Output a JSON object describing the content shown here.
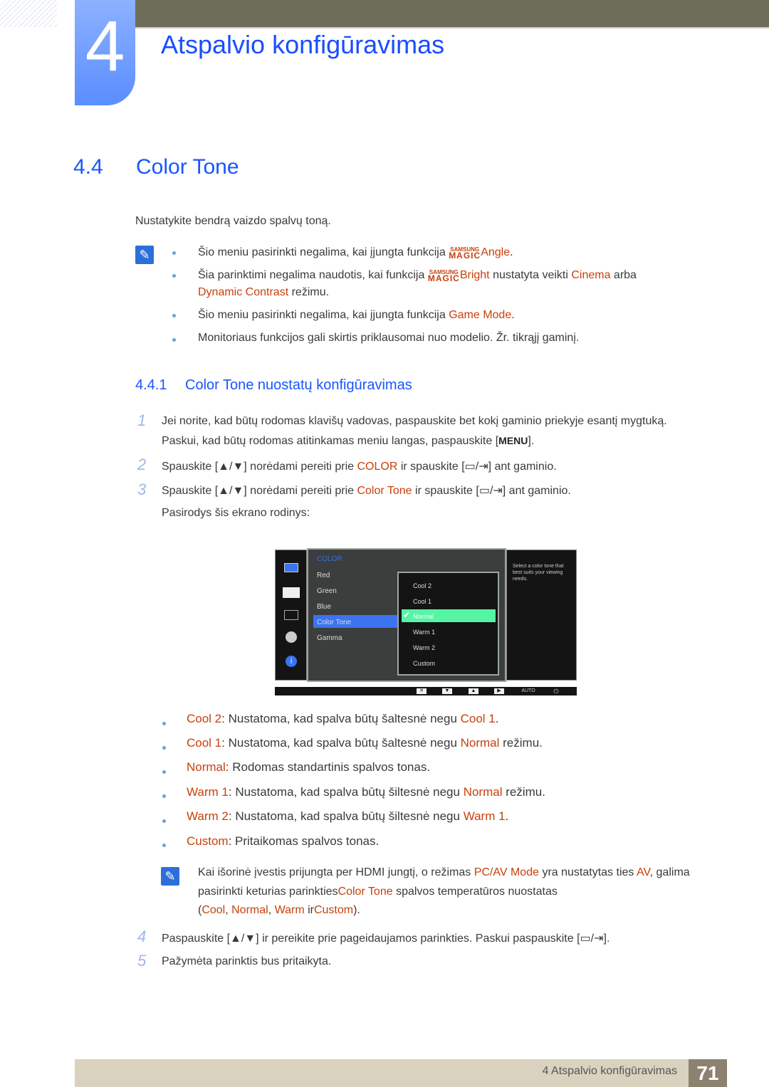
{
  "chapter": {
    "number": "4",
    "title": "Atspalvio konfigūravimas"
  },
  "section": {
    "number": "4.4",
    "title": "Color Tone"
  },
  "intro": "Nustatykite bendrą vaizdo spalvų toną.",
  "notes1": {
    "b1_pre": "Šio meniu pasirinkti negalima, kai įjungta funkcija ",
    "b1_hl": "Angle",
    "b1_post": ".",
    "b2_pre": "Šia parinktimi negalima naudotis, kai funkcija ",
    "b2_hl": "Bright",
    "b2_mid": " nustatyta veikti ",
    "b2_hl2": "Cinema",
    "b2_post": " arba",
    "b2_hl3": "Dynamic Contrast",
    "b2_post2": " režimu.",
    "b3_pre": "Šio meniu pasirinkti negalima, kai įjungta funkcija ",
    "b3_hl": "Game Mode",
    "b3_post": ".",
    "b4": "Monitoriaus funkcijos gali skirtis priklausomai nuo modelio. Žr. tikrąjį gaminį.",
    "magic_top": "SAMSUNG",
    "magic_bottom": "MAGIC"
  },
  "subsection": {
    "number": "4.4.1",
    "title": "Color Tone nuostatų konfigūravimas"
  },
  "steps": {
    "s1_num": "1",
    "s1_line1": "Jei norite, kad būtų rodomas klavišų vadovas, paspauskite bet kokį gaminio priekyje esantį mygtuką.",
    "s1_line2_pre": "Paskui, kad būtų rodomas atitinkamas meniu langas, paspauskite [",
    "s1_key": "MENU",
    "s1_line2_post": "].",
    "s2_num": "2",
    "s2_pre": "Spauskite [▲/▼] norėdami pereiti prie ",
    "s2_hl": "COLOR",
    "s2_post": " ir spauskite [▭/⇥] ant gaminio.",
    "s3_num": "3",
    "s3_pre": "Spauskite [▲/▼] norėdami pereiti prie ",
    "s3_hl": "Color Tone",
    "s3_post": " ir spauskite [▭/⇥] ant gaminio.",
    "s3_line2": "Pasirodys šis ekrano rodinys:",
    "s4_num": "4",
    "s4": "Paspauskite [▲/▼] ir pereikite prie pageidaujamos parinkties. Paskui paspauskite [▭/⇥].",
    "s5_num": "5",
    "s5": "Pažymėta parinktis bus pritaikyta."
  },
  "osd": {
    "menu_title": "COLOR",
    "menu_items": [
      "Red",
      "Green",
      "Blue",
      "Color Tone",
      "Gamma"
    ],
    "selected_menu": "Color Tone",
    "sub_items": [
      "Cool 2",
      "Cool 1",
      "Normal",
      "Warm 1",
      "Warm 2",
      "Custom"
    ],
    "selected_sub": "Normal",
    "help": "Select a color tone that best suits your viewing needs.",
    "buttons": [
      "✕",
      "▼",
      "▲",
      "▶",
      "AUTO",
      "⏻"
    ],
    "accent_color": "#3b73f0",
    "selection_color": "#55f5a5"
  },
  "options": [
    {
      "name": "Cool 2",
      "text": ": Nustatoma, kad spalva būtų šaltesnė negu ",
      "ref": "Cool 1",
      "tail": "."
    },
    {
      "name": "Cool 1",
      "text": ": Nustatoma, kad spalva būtų šaltesnė negu ",
      "ref": "Normal",
      "tail": " režimu."
    },
    {
      "name": "Normal",
      "text": ": Rodomas standartinis spalvos tonas.",
      "ref": "",
      "tail": ""
    },
    {
      "name": "Warm 1",
      "text": ": Nustatoma, kad spalva būtų šiltesnė negu ",
      "ref": "Normal",
      "tail": " režimu."
    },
    {
      "name": "Warm 2",
      "text": ": Nustatoma, kad spalva būtų šiltesnė negu ",
      "ref": "Warm 1",
      "tail": "."
    },
    {
      "name": "Custom",
      "text": ": Pritaikomas spalvos tonas.",
      "ref": "",
      "tail": ""
    }
  ],
  "note2": {
    "l1_pre": "Kai išorinė įvestis prijungta per HDMI jungtį, o režimas ",
    "l1_hl": "PC/AV Mode",
    "l1_mid": " yra nustatytas ties ",
    "l1_hl2": "AV",
    "l1_post": ", galima",
    "l2_pre": "pasirinkti keturias parinkties",
    "l2_hl": "Color Tone",
    "l2_post": " spalvos temperatūros nuostatas",
    "l3_a": "(",
    "l3_cool": "Cool",
    "l3_c1": ", ",
    "l3_normal": "Normal",
    "l3_c2": ", ",
    "l3_warm": "Warm",
    "l3_ir": " ir",
    "l3_custom": "Custom",
    "l3_end": ")."
  },
  "footer": {
    "text": "4 Atspalvio konfigūravimas",
    "page": "71"
  }
}
